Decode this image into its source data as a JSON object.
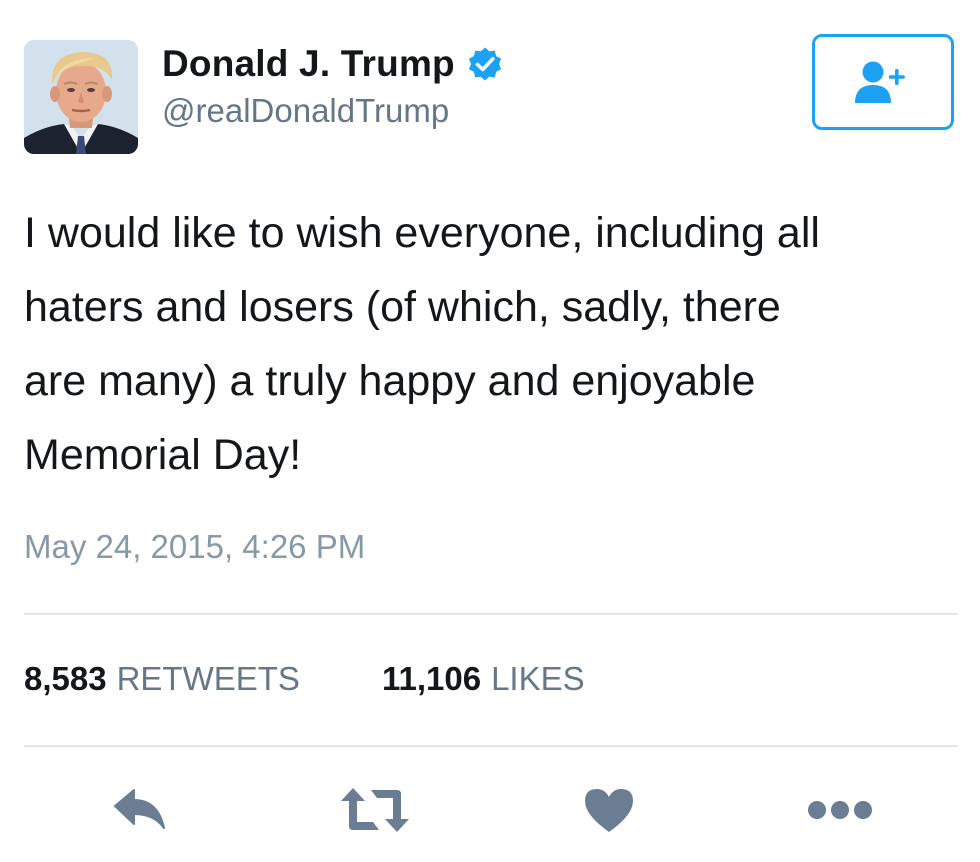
{
  "user": {
    "display_name": "Donald J. Trump",
    "handle": "@realDonaldTrump",
    "verified_icon": "verified-badge-icon",
    "avatar_icon": "profile-photo"
  },
  "follow_button": {
    "icon": "add-user-icon"
  },
  "tweet": {
    "text": "I would like to wish everyone, including all\nhaters and losers (of which, sadly, there\nare many) a truly happy and enjoyable\nMemorial Day!",
    "timestamp": "May 24, 2015, 4:26 PM"
  },
  "stats": {
    "retweets_count": "8,583",
    "retweets_label": "RETWEETS",
    "likes_count": "11,106",
    "likes_label": "LIKES"
  },
  "actions": {
    "reply_icon": "reply-icon",
    "retweet_icon": "retweet-icon",
    "like_icon": "heart-icon",
    "more_icon": "more-icon"
  },
  "colors": {
    "accent": "#1da1f2",
    "action_icon": "#6a7d92",
    "secondary_text": "#657786",
    "timestamp_text": "#8899a6",
    "divider": "#e1e8ed"
  }
}
